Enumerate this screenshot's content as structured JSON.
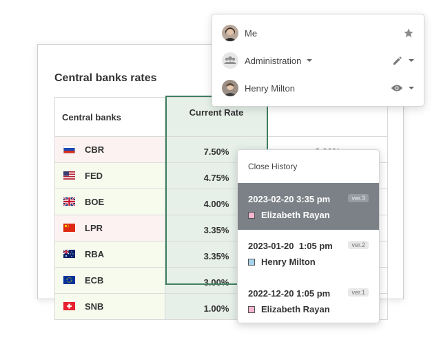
{
  "card": {
    "title": "Central banks rates",
    "headers": [
      "Central banks",
      "Current Rate"
    ],
    "rows": [
      {
        "code": "CBR",
        "rate": "7.50%",
        "flag": "russia-flag",
        "extra": "8.00%"
      },
      {
        "code": "FED",
        "rate": "4.75%",
        "flag": "usa-flag",
        "extra": ""
      },
      {
        "code": "BOE",
        "rate": "4.00%",
        "flag": "uk-flag",
        "extra": ""
      },
      {
        "code": "LPR",
        "rate": "3.35%",
        "flag": "china-flag",
        "extra": ""
      },
      {
        "code": "RBA",
        "rate": "3.35%",
        "flag": "australia-flag",
        "extra": ""
      },
      {
        "code": "ECB",
        "rate": "3.00%",
        "flag": "eu-flag",
        "extra": ""
      },
      {
        "code": "SNB",
        "rate": "1.00%",
        "flag": "swiss-flag",
        "extra": ""
      }
    ]
  },
  "users_menu": {
    "items": [
      {
        "name": "Me",
        "icon": "star-icon"
      },
      {
        "name": "Administration",
        "icon": "pencil-icon"
      },
      {
        "name": "Henry Milton",
        "icon": "eye-icon"
      }
    ]
  },
  "history": {
    "close_label": "Close History",
    "items": [
      {
        "date": "2023-02-20 3:35 pm",
        "version": "ver.3",
        "user": "Elizabeth Rayan",
        "color": "#f4b6d0"
      },
      {
        "date": "2023-01-20  1:05 pm",
        "version": "ver.2",
        "user": "Henry Milton",
        "color": "#a6d4ef"
      },
      {
        "date": "2022-12-20 1:05 pm",
        "version": "ver.1",
        "user": "Elizabeth Rayan",
        "color": "#f4b6d0"
      }
    ]
  },
  "colors": {
    "accent_green": "#3f7e5e",
    "active_history": "#7b8187"
  }
}
